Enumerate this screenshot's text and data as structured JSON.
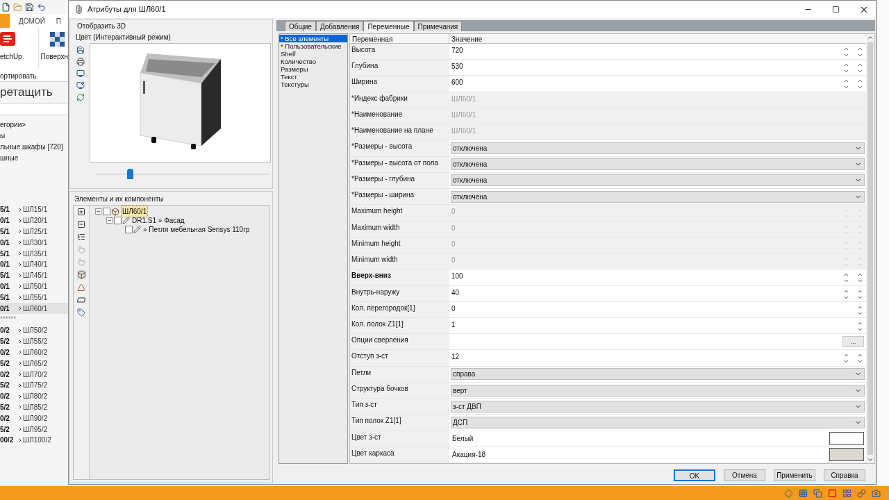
{
  "background_app": {
    "ribbon_tabs": [
      {
        "label": "ДОМОЙ",
        "selected": false
      },
      {
        "label": "П",
        "selected": false
      }
    ],
    "ribbon_labels": [
      "etchUp",
      "Поверхн",
      "ортировать"
    ],
    "heading": "ретащить",
    "categories": [
      "егории>",
      "ы",
      "льные шкафы [720]",
      "шные"
    ],
    "product_rows": [
      {
        "code": "5/1",
        "name": "ШЛ15/1",
        "selected": false
      },
      {
        "code": "0/1",
        "name": "ШЛ20/1",
        "selected": false
      },
      {
        "code": "5/1",
        "name": "ШЛ25/1",
        "selected": false
      },
      {
        "code": "0/1",
        "name": "ШЛ30/1",
        "selected": false
      },
      {
        "code": "5/1",
        "name": "ШЛ35/1",
        "selected": false
      },
      {
        "code": "0/1",
        "name": "ШЛ40/1",
        "selected": false
      },
      {
        "code": "5/1",
        "name": "ШЛ45/1",
        "selected": false
      },
      {
        "code": "0/1",
        "name": "ШЛ50/1",
        "selected": false
      },
      {
        "code": "5/1",
        "name": "ШЛ55/1",
        "selected": false
      },
      {
        "code": "0/1",
        "name": "ШЛ60/1",
        "selected": true
      }
    ],
    "separator": "******",
    "product_rows_2": [
      {
        "code": "0/2",
        "name": "ШЛ50/2",
        "selected": false
      },
      {
        "code": "5/2",
        "name": "ШЛ55/2",
        "selected": false
      },
      {
        "code": "0/2",
        "name": "ШЛ60/2",
        "selected": false
      },
      {
        "code": "5/2",
        "name": "ШЛ65/2",
        "selected": false
      },
      {
        "code": "0/2",
        "name": "ШЛ70/2",
        "selected": false
      },
      {
        "code": "5/2",
        "name": "ШЛ75/2",
        "selected": false
      },
      {
        "code": "0/2",
        "name": "ШЛ80/2",
        "selected": false
      },
      {
        "code": "5/2",
        "name": "ШЛ85/2",
        "selected": false
      },
      {
        "code": "0/2",
        "name": "ШЛ90/2",
        "selected": false
      },
      {
        "code": "5/2",
        "name": "ШЛ95/2",
        "selected": false
      },
      {
        "code": "00/2",
        "name": "ШЛ100/2",
        "selected": false
      }
    ]
  },
  "window": {
    "title": "Атрибуты для ШЛ60/1"
  },
  "preview": {
    "tab": "Отобразить 3D",
    "mode": "Цвет (Интерактивный режим)",
    "slider": {
      "level": 0.2
    }
  },
  "components": {
    "title": "Элементы и их компоненты",
    "tree": [
      {
        "label": "ШЛ60/1",
        "kind": "cabinet",
        "checked": false,
        "expanded": true,
        "selected": true,
        "children": [
          {
            "label": "DR1.S1 » Фасад",
            "kind": "part",
            "checked": false,
            "expanded": true,
            "selected": false,
            "children": [
              {
                "label": "» Петля мебельная Sensys 110гр",
                "kind": "part",
                "checked": false,
                "selected": false
              }
            ]
          }
        ]
      }
    ]
  },
  "tabs": [
    {
      "label": "Общие",
      "selected": false
    },
    {
      "label": "Добавления",
      "selected": false
    },
    {
      "label": "Переменные",
      "selected": true
    },
    {
      "label": "Примечания",
      "selected": false
    }
  ],
  "groups": [
    {
      "label": "* Все элементы",
      "selected": true
    },
    {
      "label": "* Пользовательские",
      "selected": false
    },
    {
      "label": "Shelf",
      "selected": false
    },
    {
      "label": "Количество",
      "selected": false
    },
    {
      "label": "Размеры",
      "selected": false
    },
    {
      "label": "Текст",
      "selected": false
    },
    {
      "label": "Текстуры",
      "selected": false
    }
  ],
  "table": {
    "columns": [
      "Переменная",
      "Значение"
    ],
    "rows": [
      {
        "name": "Высота",
        "value": "720",
        "kind": "spin",
        "disabled": false,
        "bold": false
      },
      {
        "name": "Глубина",
        "value": "530",
        "kind": "spin",
        "disabled": false,
        "bold": false
      },
      {
        "name": "Ширина",
        "value": "600",
        "kind": "spin",
        "disabled": false,
        "bold": false
      },
      {
        "name": "*Индекс фабрики",
        "value": "ШЛ60/1",
        "kind": "text",
        "disabled": true,
        "bold": false
      },
      {
        "name": "*Наименование",
        "value": "ШЛ60/1",
        "kind": "text",
        "disabled": true,
        "bold": false
      },
      {
        "name": "*Наименование на плане",
        "value": "ШЛ60/1",
        "kind": "text",
        "disabled": true,
        "bold": false
      },
      {
        "name": "*Размеры - высота",
        "value": "отключена",
        "kind": "select",
        "disabled": false,
        "bold": false
      },
      {
        "name": "*Размеры - высота от пола",
        "value": "отключена",
        "kind": "select",
        "disabled": false,
        "bold": false
      },
      {
        "name": "*Размеры - глубина",
        "value": "отключена",
        "kind": "select",
        "disabled": false,
        "bold": false
      },
      {
        "name": "*Размеры - ширина",
        "value": "отключена",
        "kind": "select",
        "disabled": false,
        "bold": false
      },
      {
        "name": "Maximum height",
        "value": "0",
        "kind": "spin",
        "disabled": true,
        "bold": false
      },
      {
        "name": "Maximum width",
        "value": "0",
        "kind": "spin",
        "disabled": true,
        "bold": false
      },
      {
        "name": "Minimum height",
        "value": "0",
        "kind": "spin",
        "disabled": true,
        "bold": false
      },
      {
        "name": "Minimum width",
        "value": "0",
        "kind": "spin",
        "disabled": true,
        "bold": false
      },
      {
        "name": "Вверх-вниз",
        "value": "100",
        "kind": "spin",
        "disabled": false,
        "bold": true
      },
      {
        "name": "Внутрь-наружу",
        "value": "40",
        "kind": "spin",
        "disabled": false,
        "bold": false
      },
      {
        "name": "Кол. перегородок[1]",
        "value": "0",
        "kind": "spin_single",
        "disabled": false,
        "bold": false
      },
      {
        "name": "Кол. полок Z1[1]",
        "value": "1",
        "kind": "spin_single",
        "disabled": false,
        "bold": false
      },
      {
        "name": "Опции сверления",
        "button": "...",
        "kind": "button",
        "disabled": false,
        "bold": false
      },
      {
        "name": "Отступ з-ст",
        "value": "12",
        "kind": "spin",
        "disabled": false,
        "bold": false
      },
      {
        "name": "Петли",
        "value": "справа",
        "kind": "select",
        "disabled": false,
        "bold": false
      },
      {
        "name": "Структура бочков",
        "value": "верт",
        "kind": "select",
        "disabled": false,
        "bold": false
      },
      {
        "name": "Тип з-ст",
        "value": "з-ст ДВП",
        "kind": "select",
        "disabled": false,
        "bold": false
      },
      {
        "name": "Тип полок Z1[1]",
        "value": "ДСП",
        "kind": "select",
        "disabled": false,
        "bold": false
      },
      {
        "name": "Цвет з-ст",
        "value": "Белый",
        "kind": "color",
        "color": "#ffffff",
        "disabled": false,
        "bold": false
      },
      {
        "name": "Цвет каркаса",
        "value": "Акация-18",
        "kind": "color",
        "color": "#dcd8d0",
        "disabled": false,
        "bold": false
      }
    ]
  },
  "buttons": [
    {
      "label": "OK",
      "selected": true
    },
    {
      "label": "Отмена",
      "selected": false
    },
    {
      "label": "Применить",
      "selected": false
    },
    {
      "label": "Справка",
      "selected": false
    }
  ]
}
